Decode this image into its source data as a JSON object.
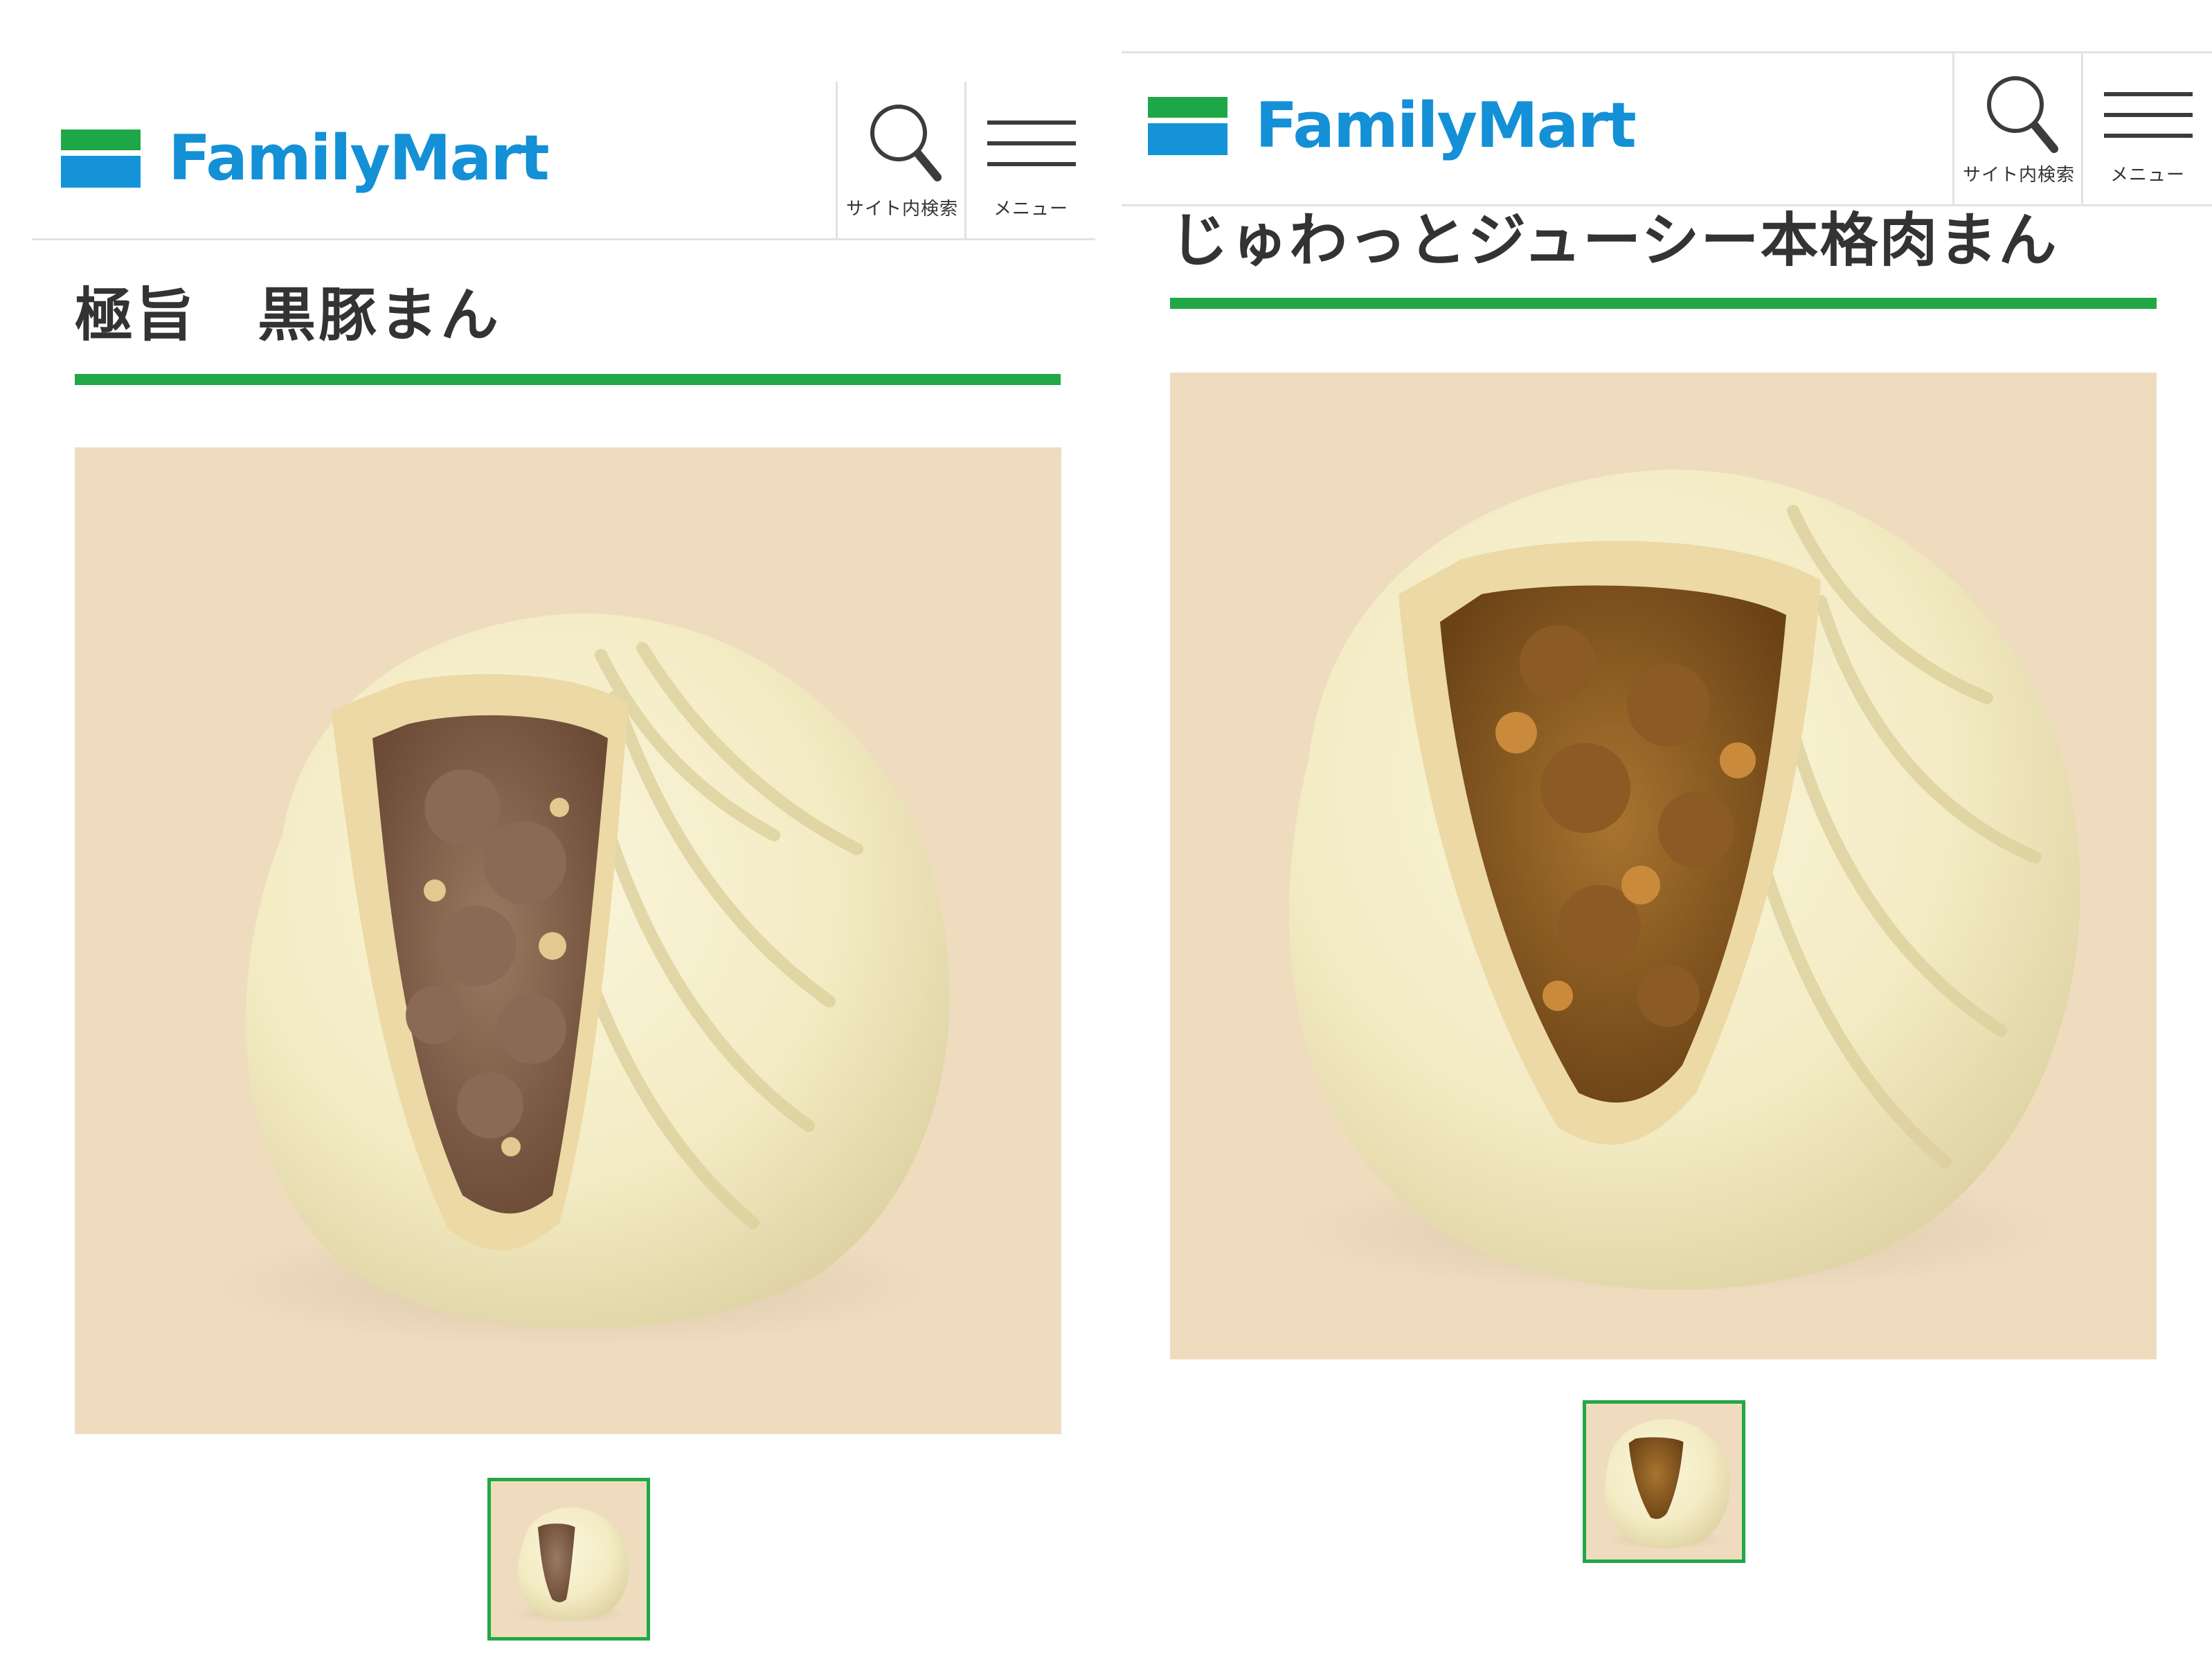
{
  "panels": [
    {
      "brand": "FamilyMart",
      "search_label": "サイト内検索",
      "menu_label": "メニュー",
      "product_title": "極旨　黒豚まん"
    },
    {
      "brand": "FamilyMart",
      "search_label": "サイト内検索",
      "menu_label": "メニュー",
      "product_title": "じゅわっとジューシー本格肉まん"
    }
  ],
  "colors": {
    "brand_blue": "#1390d6",
    "brand_green": "#1ea747",
    "accent_green": "#22a746",
    "photo_background": "#efdcbf"
  },
  "icons": [
    "search-icon",
    "menu-icon"
  ]
}
